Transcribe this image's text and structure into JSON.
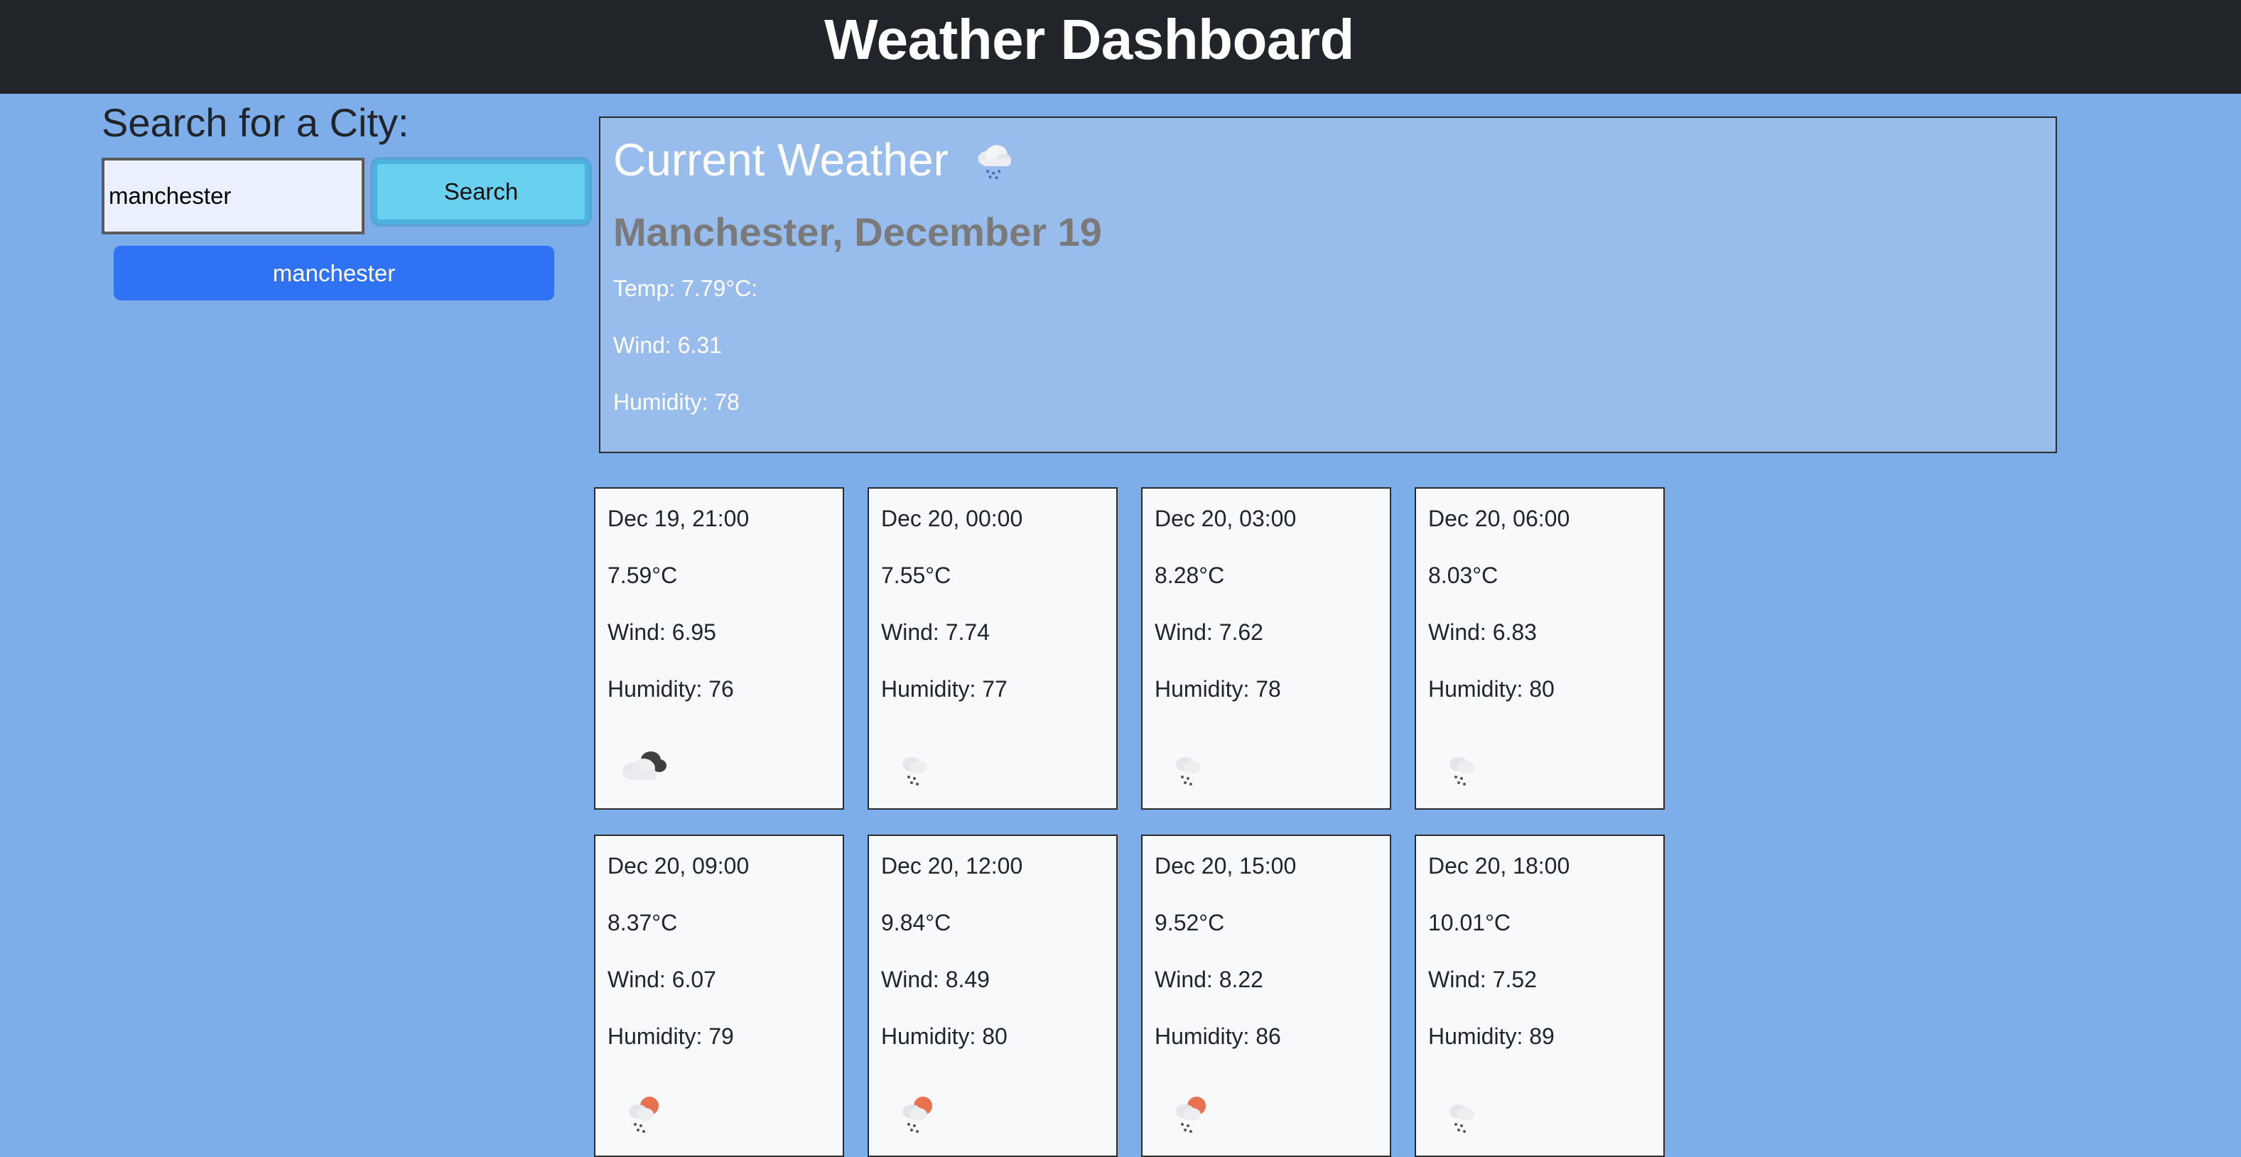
{
  "header": {
    "title": "Weather Dashboard"
  },
  "sidebar": {
    "heading": "Search for a City:",
    "search": {
      "value": "manchester",
      "button_label": "Search"
    },
    "history": [
      "manchester"
    ]
  },
  "current": {
    "heading": "Current Weather",
    "icon": "cloud-rain-icon",
    "city_date": "Manchester, December 19",
    "temp": "Temp: 7.79°C:",
    "wind": "Wind: 6.31",
    "humidity": "Humidity: 78"
  },
  "forecast": [
    {
      "datetime": "Dec 19, 21:00",
      "temp": "7.59°C",
      "wind": "Wind: 6.95",
      "humidity": "Humidity: 76",
      "icon": "broken-clouds-icon"
    },
    {
      "datetime": "Dec 20, 00:00",
      "temp": "7.55°C",
      "wind": "Wind: 7.74",
      "humidity": "Humidity: 77",
      "icon": "rain-night-icon"
    },
    {
      "datetime": "Dec 20, 03:00",
      "temp": "8.28°C",
      "wind": "Wind: 7.62",
      "humidity": "Humidity: 78",
      "icon": "rain-night-icon"
    },
    {
      "datetime": "Dec 20, 06:00",
      "temp": "8.03°C",
      "wind": "Wind: 6.83",
      "humidity": "Humidity: 80",
      "icon": "rain-night-icon"
    },
    {
      "datetime": "Dec 20, 09:00",
      "temp": "8.37°C",
      "wind": "Wind: 6.07",
      "humidity": "Humidity: 79",
      "icon": "rain-day-icon"
    },
    {
      "datetime": "Dec 20, 12:00",
      "temp": "9.84°C",
      "wind": "Wind: 8.49",
      "humidity": "Humidity: 80",
      "icon": "rain-day-icon"
    },
    {
      "datetime": "Dec 20, 15:00",
      "temp": "9.52°C",
      "wind": "Wind: 8.22",
      "humidity": "Humidity: 86",
      "icon": "rain-day-icon"
    },
    {
      "datetime": "Dec 20, 18:00",
      "temp": "10.01°C",
      "wind": "Wind: 7.52",
      "humidity": "Humidity: 89",
      "icon": "rain-night-icon"
    }
  ],
  "colors": {
    "page_background": "#7eaeea",
    "header_background": "#212529",
    "current_panel": "#98bcec",
    "search_button": "#6ad0ef",
    "history_button": "#2f73f4",
    "card_background": "#f8f9fa",
    "day_sun": "#e8714f",
    "night_moon": "#4a4a4a"
  }
}
